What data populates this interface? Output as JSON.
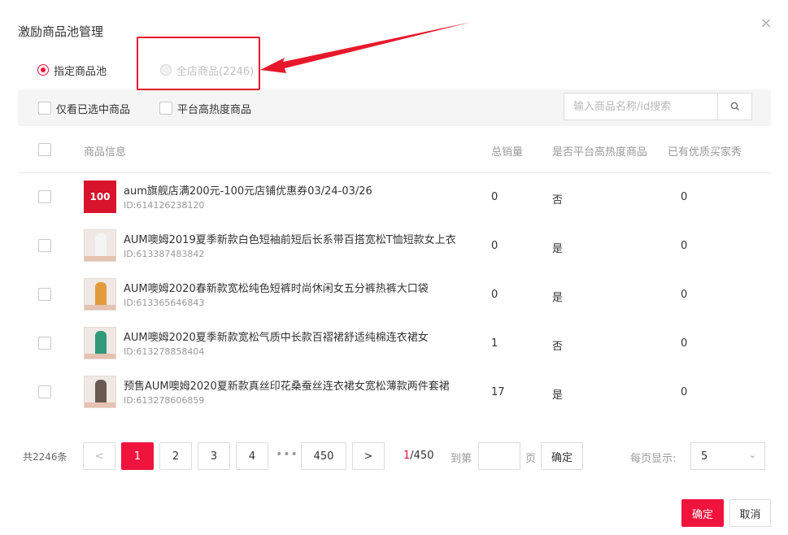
{
  "dialog": {
    "title": "激励商品池管理",
    "close_glyph": "×"
  },
  "scope_radios": [
    {
      "label": "指定商品池",
      "checked": true,
      "disabled": false
    },
    {
      "label": "全店商品(2246)",
      "checked": false,
      "disabled": true
    }
  ],
  "filters": {
    "only_selected_label": "仅看已选中商品",
    "high_heat_label": "平台高热度商品",
    "search_placeholder": "输入商品名称/id搜索",
    "search_icon": "search-icon"
  },
  "table": {
    "columns": [
      "商品信息",
      "总销量",
      "是否平台高热度商品",
      "已有优质买家秀"
    ],
    "rows": [
      {
        "thumb": "coupon",
        "thumb_text": "100",
        "name": "aum旗舰店满200元-100元店铺优惠券03/24-03/26",
        "id": "ID:614126238120",
        "sales": "0",
        "high_heat": "否",
        "showcase": "0"
      },
      {
        "thumb": "photo",
        "thumb_color": "#f4f4f4",
        "name": "AUM噢姆2019夏季新款白色短袖前短后长系带百搭宽松T恤短款女上衣",
        "id": "ID:613387483842",
        "sales": "0",
        "high_heat": "是",
        "showcase": "0"
      },
      {
        "thumb": "photo",
        "thumb_color": "#e39a3a",
        "name": "AUM噢姆2020春新款宽松纯色短裤时尚休闲女五分裤热裤大口袋",
        "id": "ID:613365646843",
        "sales": "0",
        "high_heat": "是",
        "showcase": "0"
      },
      {
        "thumb": "photo",
        "thumb_color": "#2f9a7a",
        "name": "AUM噢姆2020夏季新款宽松气质中长款百褶裙舒适纯棉连衣裙女",
        "id": "ID:613278858404",
        "sales": "1",
        "high_heat": "否",
        "showcase": "0"
      },
      {
        "thumb": "photo",
        "thumb_color": "#6a5a52",
        "name": "预售AUM噢姆2020夏新款真丝印花桑蚕丝连衣裙女宽松薄款两件套裙",
        "id": "ID:613278606859",
        "sales": "17",
        "high_heat": "是",
        "showcase": "0"
      }
    ]
  },
  "pagination": {
    "total": "共2246条",
    "prev_glyph": "<",
    "next_glyph": ">",
    "pages": [
      "1",
      "2",
      "3",
      "4"
    ],
    "ellipsis": "•••",
    "last_page": "450",
    "current_page": "1",
    "page_count_suffix": "/450",
    "goto_label": "到第",
    "goto_unit": "页",
    "goto_button": "确定",
    "page_size_label": "每页显示:",
    "page_size_value": "5"
  },
  "footer": {
    "confirm": "确定",
    "cancel": "取消"
  },
  "colors": {
    "accent": "#f0133d",
    "annotation": "#e8182b"
  }
}
